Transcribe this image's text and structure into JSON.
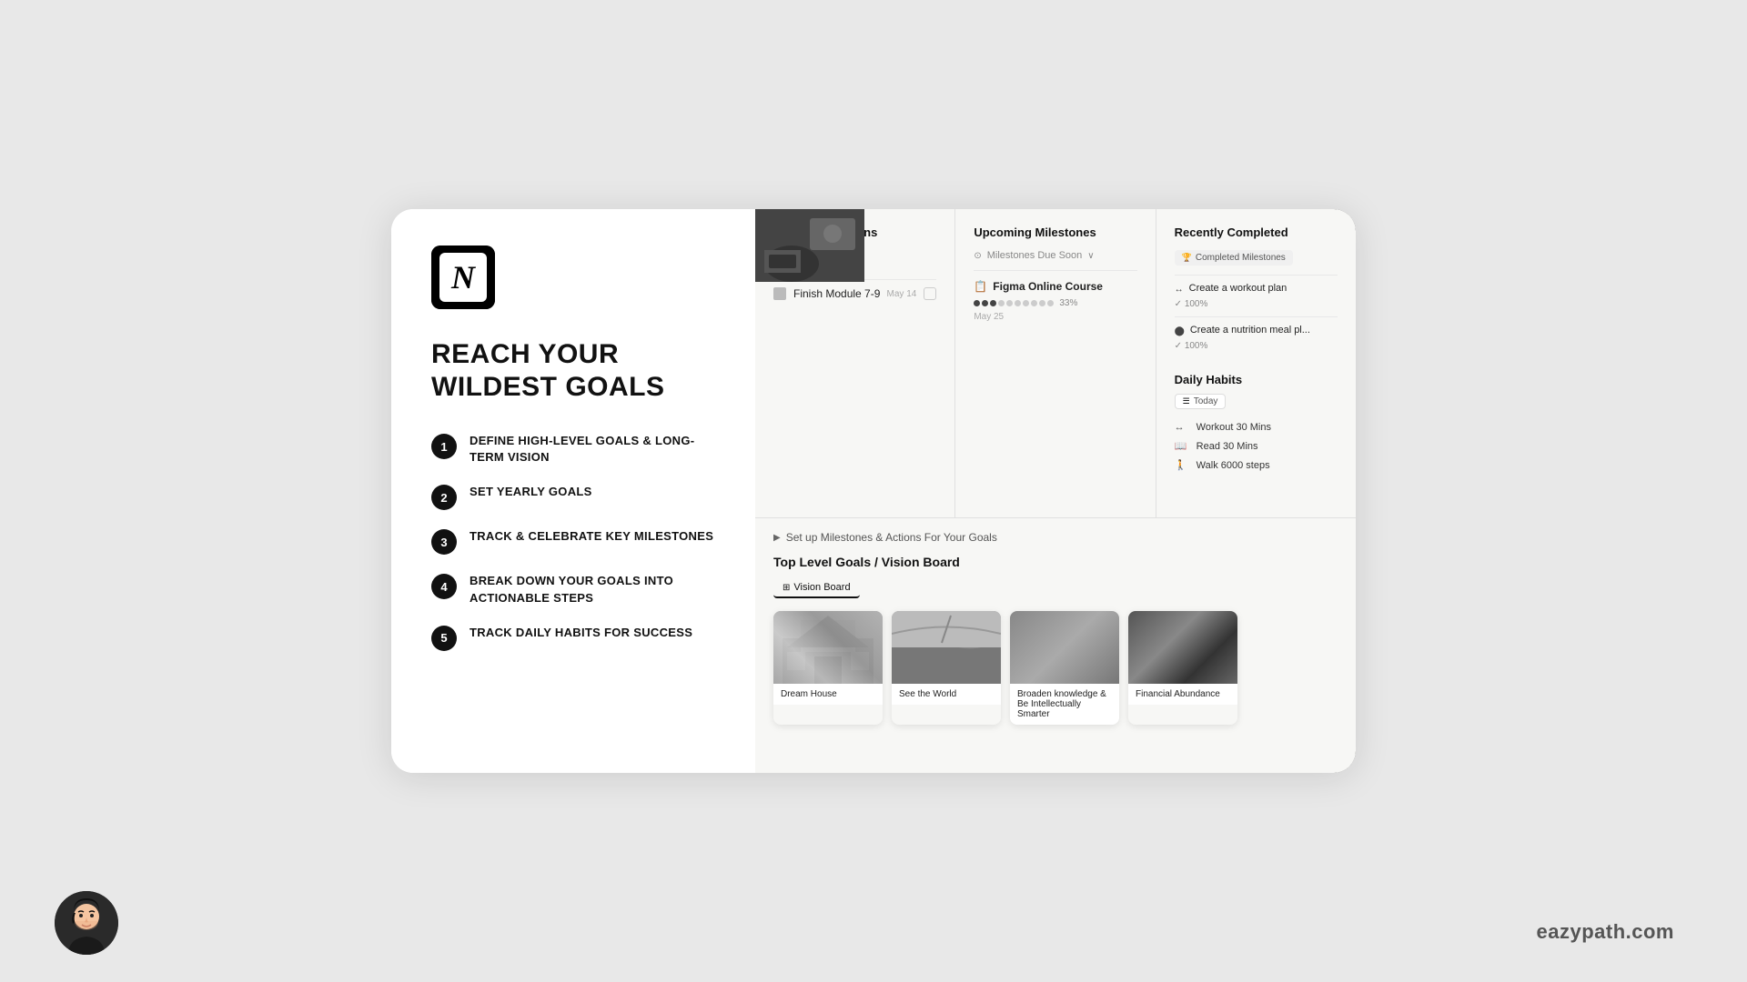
{
  "page": {
    "background": "#e8e8e8"
  },
  "left": {
    "logo_letter": "N",
    "heading_line1": "REACH YOUR",
    "heading_line2": "WILDEST GOALS",
    "steps": [
      {
        "number": "1",
        "text": "DEFINE HIGH-LEVEL GOALS & LONG-TERM VISION"
      },
      {
        "number": "2",
        "text": "SET YEARLY GOALS"
      },
      {
        "number": "3",
        "text": "TRACK & CELEBRATE KEY MILESTONES"
      },
      {
        "number": "4",
        "text": "BREAK DOWN YOUR GOALS INTO ACTIONABLE STEPS"
      },
      {
        "number": "5",
        "text": "TRACK DAILY HABITS FOR SUCCESS"
      }
    ]
  },
  "notion_ui": {
    "upcoming_actions": {
      "header": "Upcoming Actions",
      "items": [
        {
          "name": "Finish Module 7-9",
          "date": "May 14"
        }
      ]
    },
    "upcoming_milestones": {
      "header": "Upcoming Milestones",
      "filter": "Milestones Due Soon",
      "items": [
        {
          "icon": "📋",
          "name": "Figma Online Course",
          "progress_pct": "33%",
          "date": "May 25",
          "dots_filled": 3,
          "dots_total": 10
        }
      ]
    },
    "recently_completed": {
      "header": "Recently Completed",
      "tag": "Completed Milestones",
      "items": [
        {
          "name": "Create a workout plan",
          "pct": "✓ 100%"
        },
        {
          "name": "Create a nutrition meal pl...",
          "pct": "✓ 100%"
        }
      ],
      "daily_habits": {
        "header": "Daily Habits",
        "today_tag": "Today",
        "items": [
          {
            "icon": "↔",
            "text": "Workout 30 Mins"
          },
          {
            "icon": "📖",
            "text": "Read 30 Mins"
          },
          {
            "icon": "🚶",
            "text": "Walk 6000 steps"
          }
        ]
      }
    },
    "bottom": {
      "toggle_text": "Set up Milestones & Actions For Your Goals",
      "section_title": "Top Level Goals / Vision Board",
      "active_tab": "Vision Board",
      "vision_cards": [
        {
          "label": "Dream House",
          "img_class": "img-dream-house"
        },
        {
          "label": "See the World",
          "img_class": "img-see-world"
        },
        {
          "label": "Broaden knowledge & Be Intellectually Smarter",
          "img_class": "img-knowledge"
        },
        {
          "label": "Financial Abundance",
          "img_class": "img-financial"
        }
      ]
    }
  },
  "footer": {
    "website": "eazypath.com"
  }
}
